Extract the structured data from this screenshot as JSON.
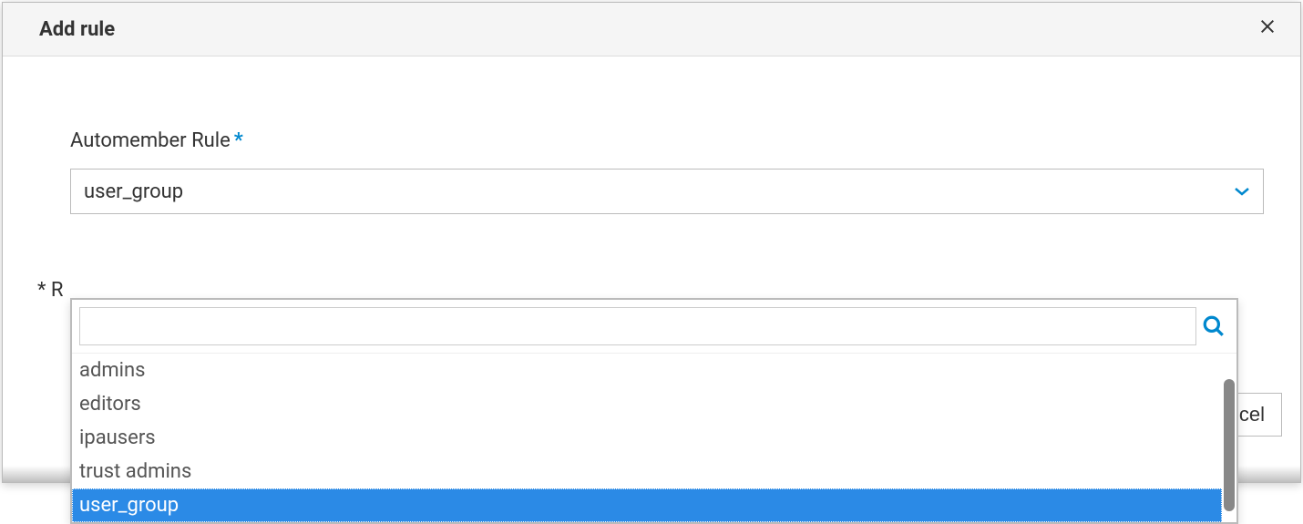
{
  "dialog": {
    "title": "Add rule",
    "field_label": "Automember Rule",
    "selected_value": "user_group",
    "options": [
      {
        "label": "admins",
        "selected": false
      },
      {
        "label": "editors",
        "selected": false
      },
      {
        "label": "ipausers",
        "selected": false
      },
      {
        "label": "trust admins",
        "selected": false
      },
      {
        "label": "user_group",
        "selected": true
      }
    ],
    "search_value": "",
    "required_note_prefix": "* R",
    "cancel_partial": "cel"
  }
}
